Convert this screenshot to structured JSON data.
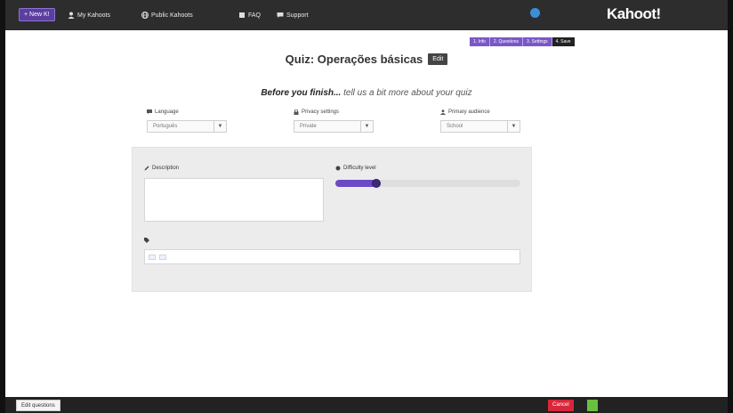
{
  "nav": {
    "new_button": "+ New K!",
    "items": [
      {
        "label": "My Kahoots",
        "extra": ""
      },
      {
        "label": "Public Kahoots",
        "extra": ""
      },
      {
        "label": "FAQ",
        "extra": ""
      },
      {
        "label": "Support",
        "extra": ""
      }
    ],
    "username": "",
    "logo": "Kahoot!"
  },
  "steps": [
    "1. Info",
    "2. Questions",
    "3. Settings",
    "4. Save"
  ],
  "page": {
    "title": "Quiz: Operações básicas",
    "edit_label": "Edit",
    "subtitle_bold": "Before you finish...",
    "subtitle_rest": " tell us a bit more about your quiz"
  },
  "settings": {
    "language": {
      "label": "Language",
      "value": "Português"
    },
    "privacy": {
      "label": "Privacy settings",
      "value": "Private"
    },
    "audience": {
      "label": "Primary audience",
      "value": "School"
    }
  },
  "panel": {
    "description_label": "Description",
    "description_count": "",
    "description_text": "",
    "difficulty_label": "Difficulty level",
    "difficulty_value": 0.22,
    "difficulty_ticks": [
      "",
      "",
      ""
    ],
    "tags_label": "",
    "tags": [
      "",
      ""
    ],
    "tags_help": ""
  },
  "bottom": {
    "edit_questions": "Edit questions",
    "cancel": "Cancel",
    "continue": ""
  },
  "colors": {
    "accent": "#6b4ac5",
    "navbar": "#2d2d2d",
    "cancel": "#d9263a",
    "continue": "#6abf3e"
  }
}
